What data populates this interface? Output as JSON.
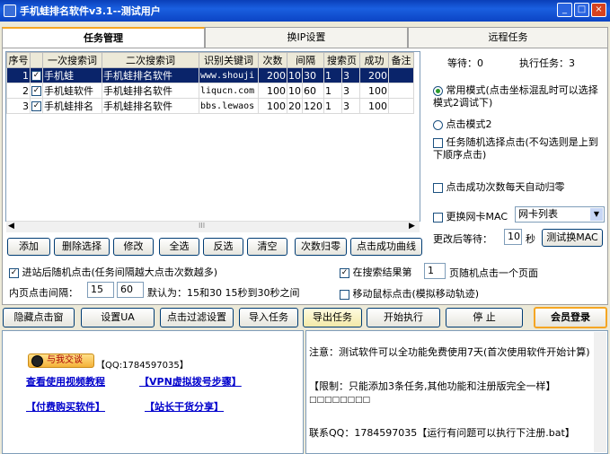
{
  "window": {
    "title": "手机蛙排名软件v3.1--测试用户",
    "min": "_",
    "max": "□",
    "close": "×"
  },
  "tabs": [
    "任务管理",
    "换IP设置",
    "远程任务"
  ],
  "grid": {
    "headers": [
      "序号",
      "",
      "一次搜索词",
      "二次搜索词",
      "识别关键词",
      "次数",
      "间隔",
      "搜索页",
      "成功",
      "备注"
    ],
    "rows": [
      {
        "no": "1",
        "check": "✓",
        "kw1": "手机蛙",
        "kw2": "手机蛙排名软件",
        "key": "www.shouji",
        "times": "200",
        "interval": "10",
        "c7": "30",
        "page": "1",
        "pageb": "3",
        "success": "200",
        "note": ""
      },
      {
        "no": "2",
        "check": "✓",
        "kw1": "手机蛙软件",
        "kw2": "手机蛙排名软件",
        "key": "liqucn.com",
        "times": "100",
        "interval": "10",
        "c7": "60",
        "page": "1",
        "pageb": "3",
        "success": "100",
        "note": ""
      },
      {
        "no": "3",
        "check": "✓",
        "kw1": "手机蛙排名",
        "kw2": "手机蛙排名软件",
        "key": "bbs.lewaos",
        "times": "100",
        "interval": "20",
        "c7": "120",
        "page": "1",
        "pageb": "3",
        "success": "100",
        "note": ""
      }
    ],
    "scroll_grip": "III"
  },
  "status": {
    "waiting": "等待：0",
    "executing": "执行任务：3"
  },
  "options": {
    "mode_common": "常用模式(点击坐标混乱时可以选择模式2调试下)",
    "mode_2": "点击模式2",
    "random_select": "任务随机选择点击(不勾选则是上到下顺序点击)",
    "auto_reset": "点击成功次数每天自动归零",
    "change_mac": "更换网卡MAC",
    "nic_list": "网卡列表",
    "wait_after_label": "更改后等待：",
    "wait_after_value": "10",
    "wait_after_unit": "秒",
    "test_mac": "测试换MAC"
  },
  "task_buttons": [
    "添加",
    "删除选择",
    "修改",
    "全选",
    "反选",
    "清空",
    "次数归零",
    "点击成功曲线"
  ],
  "settings": {
    "random_click_in": "进站后随机点击(任务间隔越大点击次数越多)",
    "inner_interval_label": "内页点击间隔：",
    "inner_from": "15",
    "inner_to": "60",
    "inner_default": "默认为：15和30  15秒到30秒之间",
    "random_in_results_pre": "在搜索结果第",
    "random_in_results_page": "1",
    "random_in_results_post": "页随机点击一个页面",
    "move_mouse": "移动鼠标点击(模拟移动轨迹)"
  },
  "action_buttons": [
    "隐藏点击窗",
    "设置UA",
    "点击过滤设置",
    "导入任务",
    "导出任务",
    "开始执行",
    "停 止",
    "会员登录"
  ],
  "left_panel": {
    "qq_badge": "与我交谈",
    "qq_text": "【QQ:1784597035】",
    "links": [
      "查看使用视频教程",
      "【VPN虚拟拨号步骤】",
      "【付费购买软件】",
      "【站长干货分享】"
    ]
  },
  "notice": {
    "line1": "注意：测试软件可以全功能免费使用7天(首次使用软件开始计算)",
    "line2": "【限制：只能添加3条任务,其他功能和注册版完全一样】",
    "line3": "□□□□□□□□",
    "line4": "联系QQ：1784597035【运行有问题可以执行下注册.bat】"
  },
  "colors": {
    "title_bar": "#0c44c4",
    "selected_row": "#0a246a",
    "link": "#0000cc",
    "tab_accent": "#f5a623"
  }
}
